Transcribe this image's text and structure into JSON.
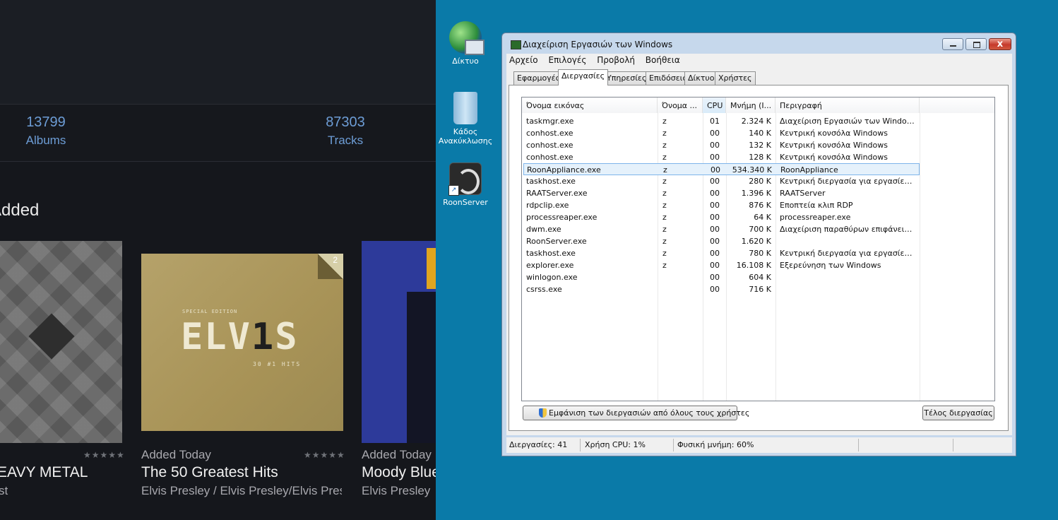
{
  "roon": {
    "stats": [
      {
        "value": "13799",
        "label": "Albums"
      },
      {
        "value": "87303",
        "label": "Tracks"
      }
    ],
    "section_title": "Added",
    "albums": [
      {
        "added": "",
        "title": "EAVY METAL",
        "artist": "st",
        "stars": "★★★★★"
      },
      {
        "added": "Added Today",
        "title": "The 50 Greatest Hits",
        "artist": "Elvis Presley / Elvis Presley/Elvis Presley",
        "stars": "★★★★★",
        "badge": "2",
        "cover_text": {
          "special": "SPECIAL EDITION",
          "elvis_a": "ELV",
          "elvis_one": "1",
          "elvis_b": "S",
          "hits": "30 #1 HITS"
        }
      },
      {
        "added": "Added Today",
        "title": "Moody Blue",
        "artist": "Elvis Presley",
        "stars": ""
      }
    ]
  },
  "desktop": {
    "icons": [
      {
        "label": "Δίκτυο",
        "icon": "network-globe-icon"
      },
      {
        "label": "Κάδος Ανακύκλωσης",
        "icon": "recycle-bin-icon"
      },
      {
        "label": "RoonServer",
        "icon": "roon-server-icon"
      }
    ]
  },
  "taskmgr": {
    "title": "Διαχείριση Εργασιών των Windows",
    "close_glyph": "x",
    "menu": [
      "Αρχείο",
      "Επιλογές",
      "Προβολή",
      "Βοήθεια"
    ],
    "tabs": [
      "Εφαρμογές",
      "Διεργασίες",
      "Υπηρεσίες",
      "Επιδόσεις",
      "Δίκτυο",
      "Χρήστες"
    ],
    "active_tab": "Διεργασίες",
    "columns": [
      "Όνομα εικόνας",
      "Όνομα ...",
      "CPU",
      "Μνήμη (Ι...",
      "Περιγραφή"
    ],
    "rows": [
      {
        "name": "taskmgr.exe",
        "user": "z",
        "cpu": "01",
        "mem": "2.324 K",
        "desc": "Διαχείριση Εργασιών των Windows"
      },
      {
        "name": "conhost.exe",
        "user": "z",
        "cpu": "00",
        "mem": "140 K",
        "desc": "Κεντρική κονσόλα Windows"
      },
      {
        "name": "conhost.exe",
        "user": "z",
        "cpu": "00",
        "mem": "132 K",
        "desc": "Κεντρική κονσόλα Windows"
      },
      {
        "name": "conhost.exe",
        "user": "z",
        "cpu": "00",
        "mem": "128 K",
        "desc": "Κεντρική κονσόλα Windows"
      },
      {
        "name": "RoonAppliance.exe",
        "user": "z",
        "cpu": "00",
        "mem": "534.340 K",
        "desc": "RoonAppliance",
        "selected": true
      },
      {
        "name": "taskhost.exe",
        "user": "z",
        "cpu": "00",
        "mem": "280 K",
        "desc": "Κεντρική διεργασία για εργασίες των ..."
      },
      {
        "name": "RAATServer.exe",
        "user": "z",
        "cpu": "00",
        "mem": "1.396 K",
        "desc": "RAATServer"
      },
      {
        "name": "rdpclip.exe",
        "user": "z",
        "cpu": "00",
        "mem": "876 K",
        "desc": "Εποπτεία κλιπ RDP"
      },
      {
        "name": "processreaper.exe",
        "user": "z",
        "cpu": "00",
        "mem": "64 K",
        "desc": "processreaper.exe"
      },
      {
        "name": "dwm.exe",
        "user": "z",
        "cpu": "00",
        "mem": "700 K",
        "desc": "Διαχείριση παραθύρων επιφάνειας ερ..."
      },
      {
        "name": "RoonServer.exe",
        "user": "z",
        "cpu": "00",
        "mem": "1.620 K",
        "desc": ""
      },
      {
        "name": "taskhost.exe",
        "user": "z",
        "cpu": "00",
        "mem": "780 K",
        "desc": "Κεντρική διεργασία για εργασίες των ..."
      },
      {
        "name": "explorer.exe",
        "user": "z",
        "cpu": "00",
        "mem": "16.108 K",
        "desc": "Εξερεύνηση των Windows"
      },
      {
        "name": "winlogon.exe",
        "user": "",
        "cpu": "00",
        "mem": "604 K",
        "desc": ""
      },
      {
        "name": "csrss.exe",
        "user": "",
        "cpu": "00",
        "mem": "716 K",
        "desc": ""
      }
    ],
    "show_all_button": "Εμφάνιση των διεργασιών από όλους τους χρήστες",
    "end_process_button": "Τέλος διεργασίας",
    "status": {
      "processes": "Διεργασίες: 41",
      "cpu": "Χρήση CPU: 1%",
      "memory": "Φυσική μνήμη: 60%"
    }
  }
}
